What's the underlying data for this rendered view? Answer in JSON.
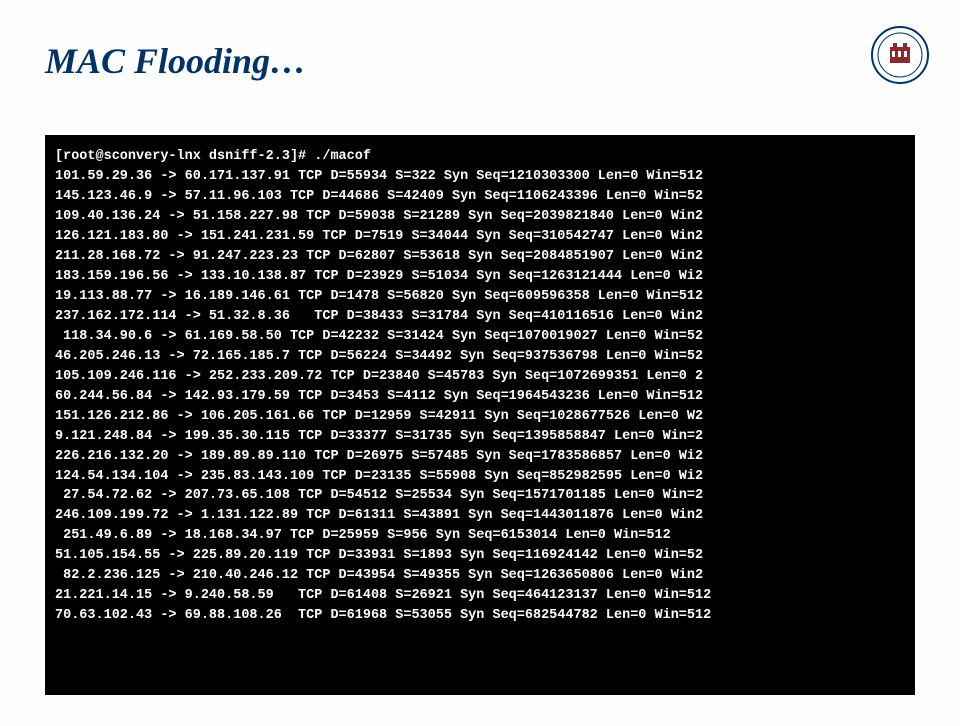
{
  "title": "MAC Flooding…",
  "terminal_lines": [
    "[root@sconvery-lnx dsniff-2.3]# ./macof",
    "101.59.29.36 -> 60.171.137.91 TCP D=55934 S=322 Syn Seq=1210303300 Len=0 Win=512",
    "145.123.46.9 -> 57.11.96.103 TCP D=44686 S=42409 Syn Seq=1106243396 Len=0 Win=52",
    "109.40.136.24 -> 51.158.227.98 TCP D=59038 S=21289 Syn Seq=2039821840 Len=0 Win2",
    "126.121.183.80 -> 151.241.231.59 TCP D=7519 S=34044 Syn Seq=310542747 Len=0 Win2",
    "211.28.168.72 -> 91.247.223.23 TCP D=62807 S=53618 Syn Seq=2084851907 Len=0 Win2",
    "183.159.196.56 -> 133.10.138.87 TCP D=23929 S=51034 Syn Seq=1263121444 Len=0 Wi2",
    "19.113.88.77 -> 16.189.146.61 TCP D=1478 S=56820 Syn Seq=609596358 Len=0 Win=512",
    "237.162.172.114 -> 51.32.8.36   TCP D=38433 S=31784 Syn Seq=410116516 Len=0 Win2",
    " 118.34.90.6 -> 61.169.58.50 TCP D=42232 S=31424 Syn Seq=1070019027 Len=0 Win=52",
    "46.205.246.13 -> 72.165.185.7 TCP D=56224 S=34492 Syn Seq=937536798 Len=0 Win=52",
    "105.109.246.116 -> 252.233.209.72 TCP D=23840 S=45783 Syn Seq=1072699351 Len=0 2",
    "60.244.56.84 -> 142.93.179.59 TCP D=3453 S=4112 Syn Seq=1964543236 Len=0 Win=512",
    "151.126.212.86 -> 106.205.161.66 TCP D=12959 S=42911 Syn Seq=1028677526 Len=0 W2",
    "9.121.248.84 -> 199.35.30.115 TCP D=33377 S=31735 Syn Seq=1395858847 Len=0 Win=2",
    "226.216.132.20 -> 189.89.89.110 TCP D=26975 S=57485 Syn Seq=1783586857 Len=0 Wi2",
    "124.54.134.104 -> 235.83.143.109 TCP D=23135 S=55908 Syn Seq=852982595 Len=0 Wi2",
    " 27.54.72.62 -> 207.73.65.108 TCP D=54512 S=25534 Syn Seq=1571701185 Len=0 Win=2",
    "246.109.199.72 -> 1.131.122.89 TCP D=61311 S=43891 Syn Seq=1443011876 Len=0 Win2",
    " 251.49.6.89 -> 18.168.34.97 TCP D=25959 S=956 Syn Seq=6153014 Len=0 Win=512",
    "51.105.154.55 -> 225.89.20.119 TCP D=33931 S=1893 Syn Seq=116924142 Len=0 Win=52",
    " 82.2.236.125 -> 210.40.246.12 TCP D=43954 S=49355 Syn Seq=1263650806 Len=0 Win2",
    "21.221.14.15 -> 9.240.58.59   TCP D=61408 S=26921 Syn Seq=464123137 Len=0 Win=512",
    "70.63.102.43 -> 69.88.108.26  TCP D=61968 S=53055 Syn Seq=682544782 Len=0 Win=512"
  ]
}
